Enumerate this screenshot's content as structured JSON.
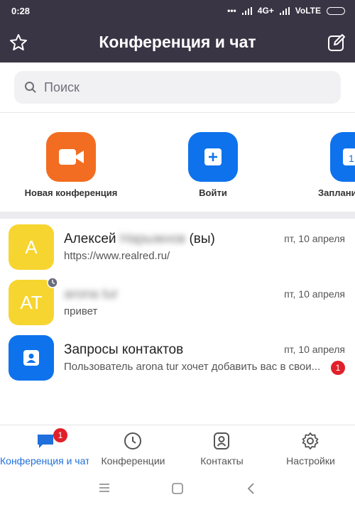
{
  "status_bar": {
    "time": "0:28",
    "network": "4G+",
    "carrier": "VoLTE"
  },
  "header": {
    "title": "Конференция и чат",
    "left_icon": "star-icon",
    "right_icon": "compose-icon"
  },
  "search": {
    "placeholder": "Поиск"
  },
  "quick_actions": [
    {
      "label": "Новая конференция",
      "icon": "video-camera-icon",
      "color": "#f26d21"
    },
    {
      "label": "Войти",
      "icon": "plus-icon",
      "color": "#0e72ed"
    },
    {
      "label": "Заплани",
      "icon": "calendar-icon",
      "color": "#0e72ed"
    }
  ],
  "chats": [
    {
      "avatar": "A",
      "avatar_color": "#f7d530",
      "name": "Алексей",
      "name_hidden": "Нарыжнов",
      "name_suffix": "(вы)",
      "subtitle": "https://www.realred.ru/",
      "date": "пт, 10 апреля"
    },
    {
      "avatar": "AT",
      "avatar_color": "#f7d530",
      "name_hidden": "arona tur",
      "subtitle": "привет",
      "date": "пт, 10 апреля"
    },
    {
      "avatar_icon": "contact-card-icon",
      "avatar_color": "#0e72ed",
      "name": "Запросы контактов",
      "subtitle": "Пользователь arona tur хочет добавить вас в свои...",
      "date": "пт, 10 апреля",
      "badge": "1"
    }
  ],
  "tabs": [
    {
      "label": "Конференция и чат",
      "icon": "chat-bubble-icon",
      "badge": "1",
      "active": true
    },
    {
      "label": "Конференции",
      "icon": "clock-icon"
    },
    {
      "label": "Контакты",
      "icon": "contacts-icon"
    },
    {
      "label": "Настройки",
      "icon": "gear-icon"
    }
  ],
  "colors": {
    "header_bg": "#3a3545",
    "accent": "#1f6fdc",
    "badge": "#e0212a"
  }
}
